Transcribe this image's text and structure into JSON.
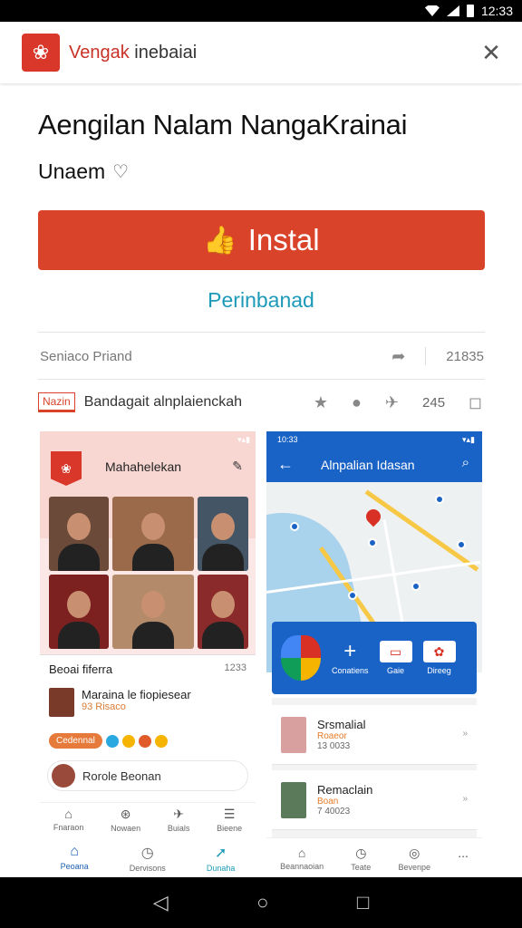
{
  "statusbar": {
    "time": "12:33"
  },
  "appbar": {
    "brand_part1": "Vengak",
    "brand_part2": " inebaiai"
  },
  "app": {
    "title": "Aengilan Nalam NangaKrainai",
    "subtitle": "Unaem",
    "install_label": "Instal",
    "secondary_link": "Perinbanad"
  },
  "meta_row": {
    "left": "Seniaco Priand",
    "right": "21835"
  },
  "info_row": {
    "badge": "Nazin",
    "text": "Bandagait alnplaienckah",
    "count": "245"
  },
  "left_screenshot": {
    "status": "▾▴▮",
    "header_title": "Mahahelekan",
    "card_header": "Beoai fiferra",
    "card_time": "1233",
    "item_title": "Maraina le fiopiesear",
    "item_sub": "93 Risaco",
    "pill": "Cedennal",
    "comment": "Rorole Beonan",
    "nav_top": [
      "Fnaraon",
      "Nowaen",
      "Buials",
      "Bieene"
    ],
    "nav_bottom": [
      "Peoana",
      "Dervisons",
      "Dunaha"
    ]
  },
  "right_screenshot": {
    "status_time": "10:33",
    "header_title": "Alnpalian Idasan",
    "panel_buttons": [
      "Conatiens",
      "Gaie",
      "Direeg"
    ],
    "cards": [
      {
        "title": "Srsmalial",
        "sub": "Roaeor",
        "meta": "13 0033"
      },
      {
        "title": "Remaclain",
        "sub": "Boan",
        "meta": "7 40023"
      }
    ],
    "nav": [
      "Beannaoian",
      "Teate",
      "Bevenpe",
      "..."
    ]
  },
  "colors": {
    "accent": "#d9432a",
    "link": "#1c9ab8",
    "map_blue": "#1a63c6"
  }
}
